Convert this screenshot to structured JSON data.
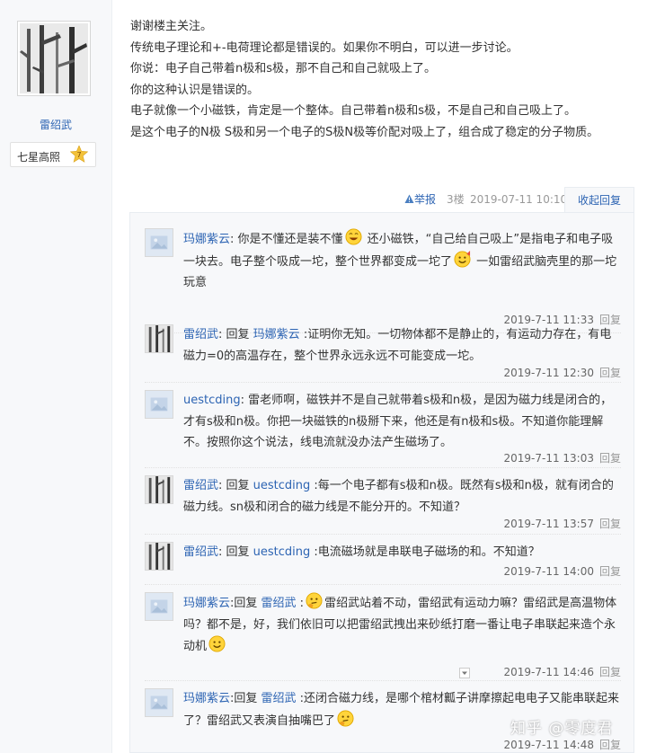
{
  "author": {
    "name": "雷绍武",
    "badge_label": "七星高照",
    "badge_level": "7"
  },
  "post": {
    "lines": [
      "谢谢楼主关注。",
      "传统电子理论和+-电荷理论都是错误的。如果你不明白，可以进一步讨论。",
      "你说：电子自己带着n极和s极，那不自己和自己就吸上了。",
      "你的这种认识是错误的。",
      "电子就像一个小磁铁，肯定是一个整体。自己带着n极和s极，不是自己和自己吸上了。",
      "是这个电子的N极 S极和另一个电子的S极N极等价配对吸上了，组合成了稳定的分子物质。"
    ],
    "report_label": "举报",
    "floor": "3楼",
    "time": "2019-07-11 10:10",
    "collapse_label": "收起回复"
  },
  "replies": [
    {
      "user": "玛娜紫云",
      "reply_word": "",
      "target": "",
      "t1": ": 你是不懂还是装不懂",
      "t2": " 还小磁铁，“自己给自己吸上”是指电子和电子吸一块去。电子整个吸成一坨，整个世界都变成一坨了",
      "t3": " 一如雷绍武脑壳里的那一坨玩意",
      "time": "2019-7-11 11:33",
      "reply_label": "回复"
    },
    {
      "user": "雷绍武",
      "reply_word": ": 回复 ",
      "target": "玛娜紫云",
      "t1": " :证明你无知。一切物体都不是静止的，有运动力存在，有电磁力=0的高温存在，整个世界永远永远不可能变成一坨。",
      "time": "2019-7-11 12:30",
      "reply_label": "回复"
    },
    {
      "user": "uestcding",
      "reply_word": "",
      "target": "",
      "t1": ": 雷老师啊，磁铁并不是自己就带着s极和n极，是因为磁力线是闭合的，才有s极和n极。你把一块磁铁的n极掰下来，他还是有n极和s极。不知道你能理解不。按照你这个说法，线电流就没办法产生磁场了。",
      "time": "2019-7-11 13:03",
      "reply_label": "回复"
    },
    {
      "user": "雷绍武",
      "reply_word": ": 回复 ",
      "target": "uestcding",
      "t1": " :每一个电子都有s极和n极。既然有s极和n极，就有闭合的磁力线。sn极和闭合的磁力线是不能分开的。不知道？",
      "time": "2019-7-11 13:57",
      "reply_label": "回复"
    },
    {
      "user": "雷绍武",
      "reply_word": ": 回复 ",
      "target": "uestcding",
      "t1": " :电流磁场就是串联电子磁场的和。不知道？",
      "time": "2019-7-11 14:00",
      "reply_label": "回复"
    },
    {
      "user": "玛娜紫云",
      "reply_word": ":回复 ",
      "target": "雷绍武",
      "t1": " :",
      "t2": "雷绍武站着不动，雷绍武有运动力嘛？雷绍武是高温物体吗？都不是，好，我们依旧可以把雷绍武拽出来砂纸打磨一番让电子串联起来造个永动机",
      "time": "2019-7-11 14:46",
      "reply_label": "回复"
    },
    {
      "user": "玛娜紫云",
      "reply_word": ":回复 ",
      "target": "雷绍武",
      "t1": " :还闭合磁力线，是哪个棺材瓤子讲摩擦起电电子又能串联起来了？雷绍武又表演自抽嘴巴了",
      "time": "2019-7-11 14:48",
      "reply_label": "回复"
    }
  ],
  "watermark": "知乎 @零度君"
}
